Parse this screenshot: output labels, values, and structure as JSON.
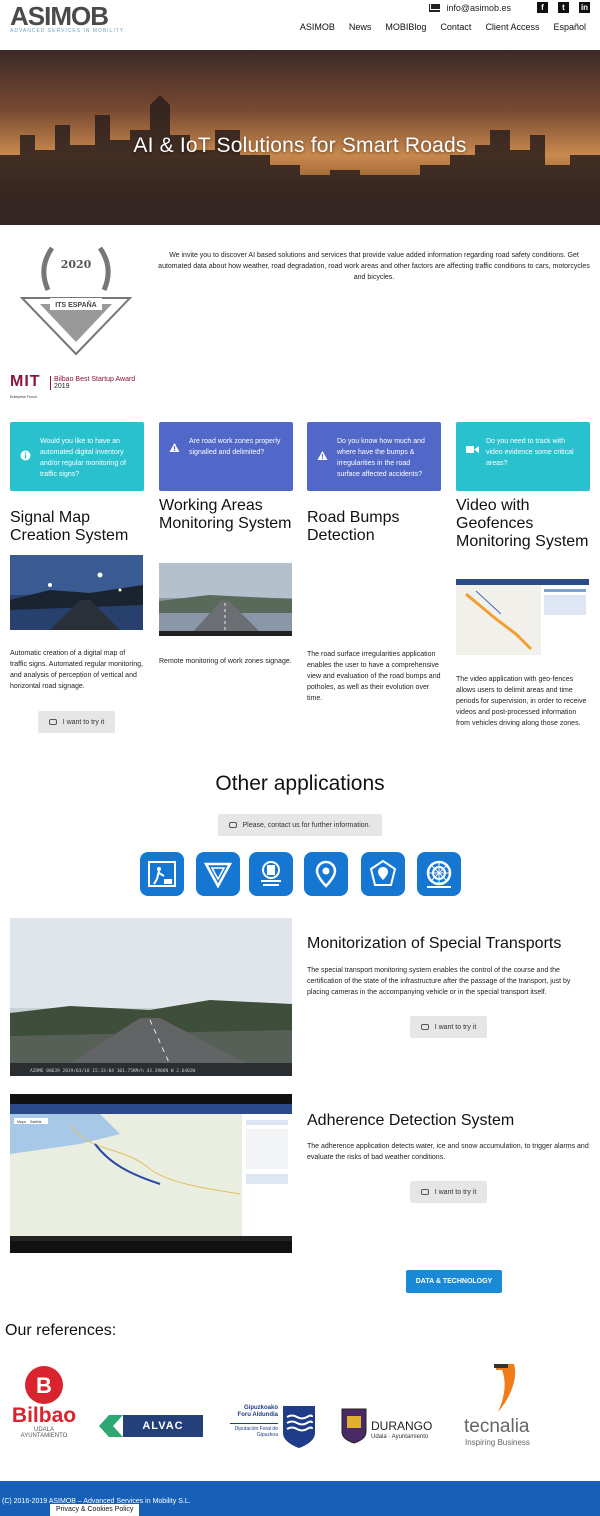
{
  "header": {
    "logo_text": "ASIMOB",
    "logo_tagline": "ADVANCED SERVICES IN MOBILITY",
    "email": "info@asimob.es",
    "social": [
      "f",
      "t",
      "in"
    ],
    "nav": [
      "ASIMOB",
      "News",
      "MOBIBlog",
      "Contact",
      "Client Access",
      "Español"
    ]
  },
  "hero": {
    "title": "AI & IoT Solutions for Smart Roads"
  },
  "intro": {
    "award_year": "2020",
    "award_name": "ITS ESPAÑA",
    "text": "We invite you to discover AI based solutions and services that provide value added information regarding road safety conditions. Get automated data about how weather, road degradation,  road work areas and other factors are affecting  traffic conditions to cars, motorcycles and bicycles.",
    "mit_logo": "MIT",
    "mit_sub": "Enterprise Forum",
    "mit_award_prefix": "Bilbao Best Startup Award",
    "mit_award_year": "2019"
  },
  "cards": [
    {
      "text": "Would you like to have an automated digital inventory and/or regular monitoring of traffic signs?",
      "icon": "info-icon",
      "color": "#28c1cd"
    },
    {
      "text": "Are road work zones properly signalled and delimited?",
      "icon": "warning-icon",
      "color": "#5168c8"
    },
    {
      "text": "Do you know how much and where have the bumps & irregularities in the road surface affected accidents?",
      "icon": "warning-icon",
      "color": "#5168c8"
    },
    {
      "text": "Do you need to track with video evidence some critical areas?",
      "icon": "video-icon",
      "color": "#28c1cd"
    }
  ],
  "columns": [
    {
      "title": "Signal Map Creation System",
      "desc": "Automatic creation of a digital map of traffic signs. Automated regular monitoring, and analysis of perception of vertical and horizontal road signage."
    },
    {
      "title": "Working Areas Monitoring System",
      "desc": "Remote monitoring of work zones signage."
    },
    {
      "title": "Road Bumps Detection",
      "desc": "The road surface irregularities application enables the user to have a comprehensive view and evaluation of the road bumps and potholes, as well as their evolution over time."
    },
    {
      "title": "Video with Geofences Monitoring System",
      "desc": "The video application with geo-fences allows users to delimit areas and time periods for supervision, in order to receive videos and post-processed information from vehicles driving along those zones."
    }
  ],
  "try_label": "I want to try it",
  "other": {
    "title": "Other applications",
    "contact_label": "Please, contact us for further information.",
    "icons": [
      "roadwork-icon",
      "yield-sign-icon",
      "traffic-light-icon",
      "location-pin-icon",
      "geofence-pin-icon",
      "wheel-icon"
    ]
  },
  "sections": [
    {
      "title": "Monitorization of Special Transports",
      "desc": "The special transport monitoring system enables the control of the course and the certification of the state of the infrastructure after the passage of the transport, just by placing cameras in the accompanying vehicle or in the special transport itself.",
      "overlay": "AZOME 00639 2019/03/18 15:33:04 101.75KM/h 43.3906N W 2.6402W"
    },
    {
      "title": "Adherence Detection System",
      "desc": "The adherence application detects water, ice and snow accumulation, to trigger alarms and evaluate the risks of bad weather conditions.",
      "map_tabs": [
        "Mapa",
        "Satélite"
      ]
    }
  ],
  "data_tech_label": "DATA & TECHNOLOGY",
  "references": {
    "title": "Our references:",
    "items": [
      {
        "name": "Bilbao",
        "sub1": "UDALA",
        "sub2": "AYUNTAMIENTO"
      },
      {
        "name": "ALVAC"
      },
      {
        "name": "Gipuzkoako Foru Aldundia",
        "sub1": "Diputación Foral de Gipuzkoa"
      },
      {
        "name": "DURANGO",
        "sub1": "Udala · Ayuntamiento"
      },
      {
        "name": "tecnalia",
        "sub1": "Inspiring Business"
      }
    ]
  },
  "footer": {
    "copyright": "(C) 2016-2019 ASIMOB – Advanced Services in Mobility S.L.",
    "privacy": "Privacy & Cookies Policy"
  }
}
